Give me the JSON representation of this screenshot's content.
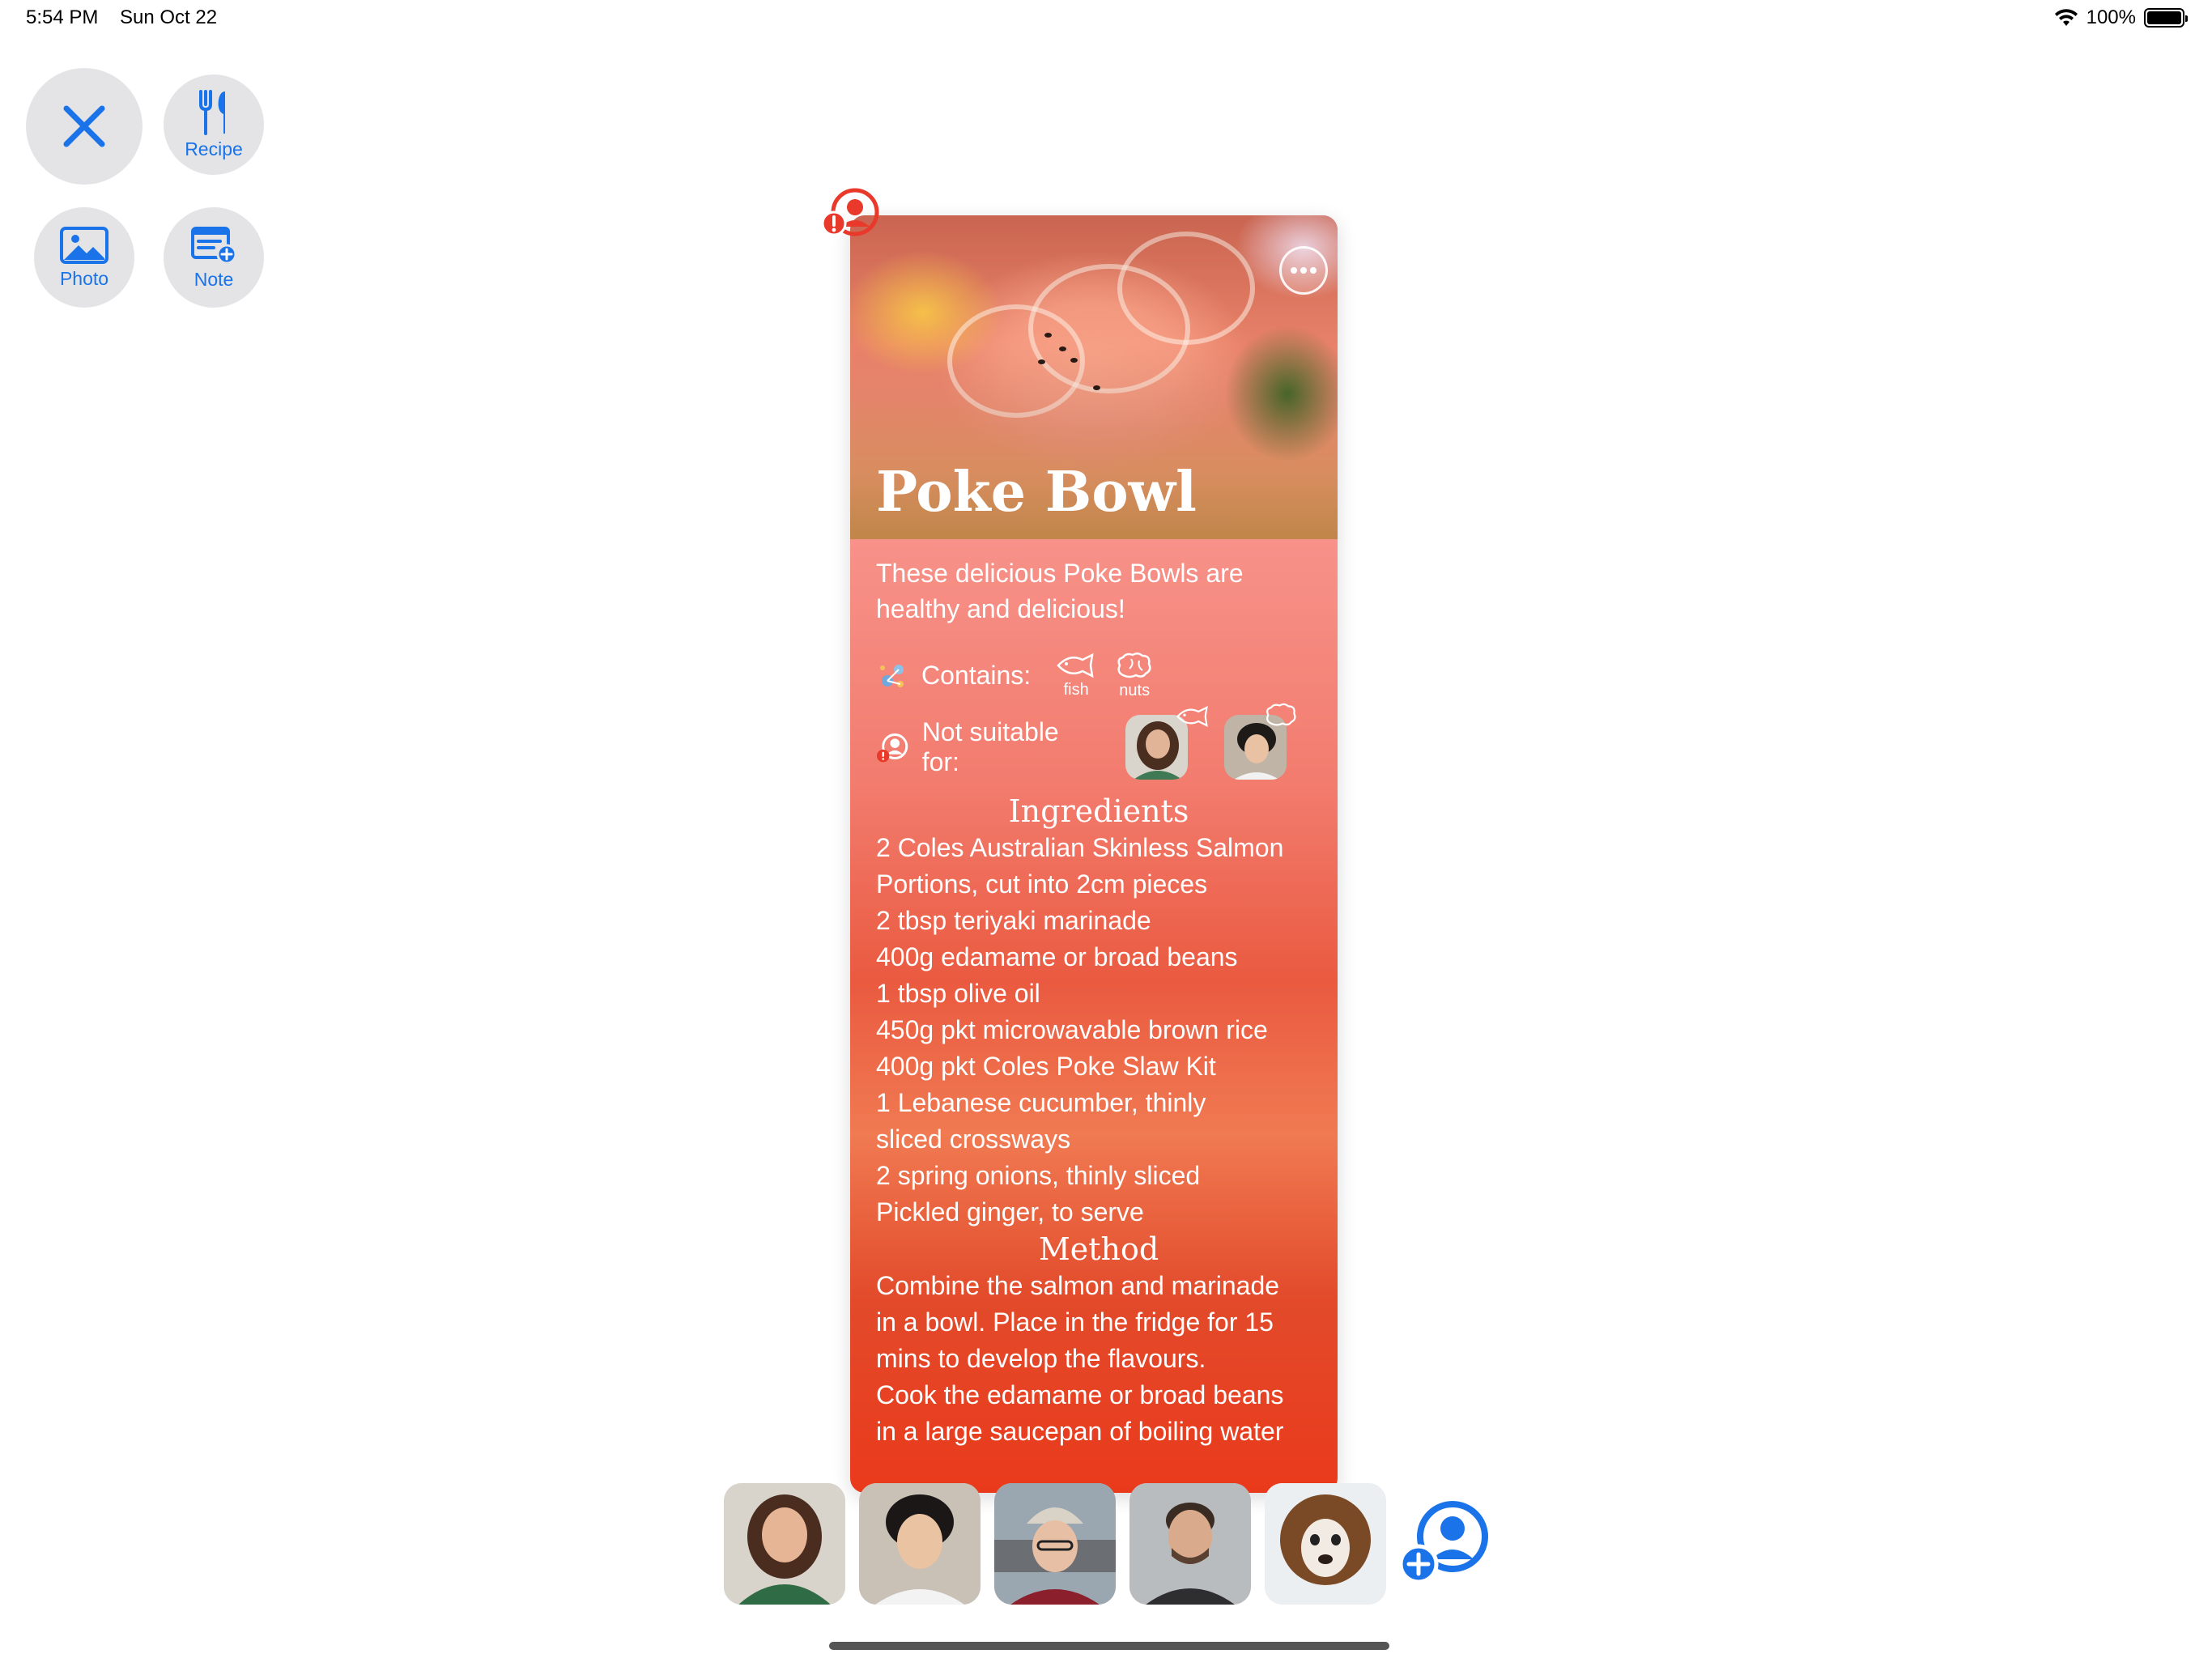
{
  "status_bar": {
    "time": "5:54 PM",
    "date": "Sun Oct 22",
    "battery": "100%"
  },
  "toolbar": {
    "recipe_label": "Recipe",
    "photo_label": "Photo",
    "note_label": "Note"
  },
  "card": {
    "title": "Poke Bowl",
    "description": [
      "These delicious Poke Bowls are",
      "healthy and delicious!"
    ],
    "contains_label": "Contains:",
    "allergens": [
      {
        "name": "fish",
        "icon": "fish-icon"
      },
      {
        "name": "nuts",
        "icon": "brain-nuts-icon"
      }
    ],
    "not_suitable_label": "Not suitable for:",
    "ingredients_title": "Ingredients",
    "ingredients": [
      "2 Coles Australian Skinless Salmon",
      "Portions, cut into 2cm pieces",
      "2 tbsp teriyaki marinade",
      "400g edamame or broad beans",
      "1 tbsp olive oil",
      "450g pkt microwavable brown rice",
      "400g pkt Coles Poke Slaw Kit",
      "1 Lebanese cucumber, thinly",
      "sliced crossways",
      "2 spring onions, thinly sliced",
      "Pickled ginger, to serve"
    ],
    "method_title": "Method",
    "method": [
      "Combine the salmon and marinade",
      "in a bowl. Place in the fridge for 15",
      "mins to develop the flavours.",
      "Cook the edamame or broad beans",
      "in a large saucepan of boiling water"
    ]
  },
  "colors": {
    "accent": "#1a73e8",
    "alert": "#e8392a"
  }
}
